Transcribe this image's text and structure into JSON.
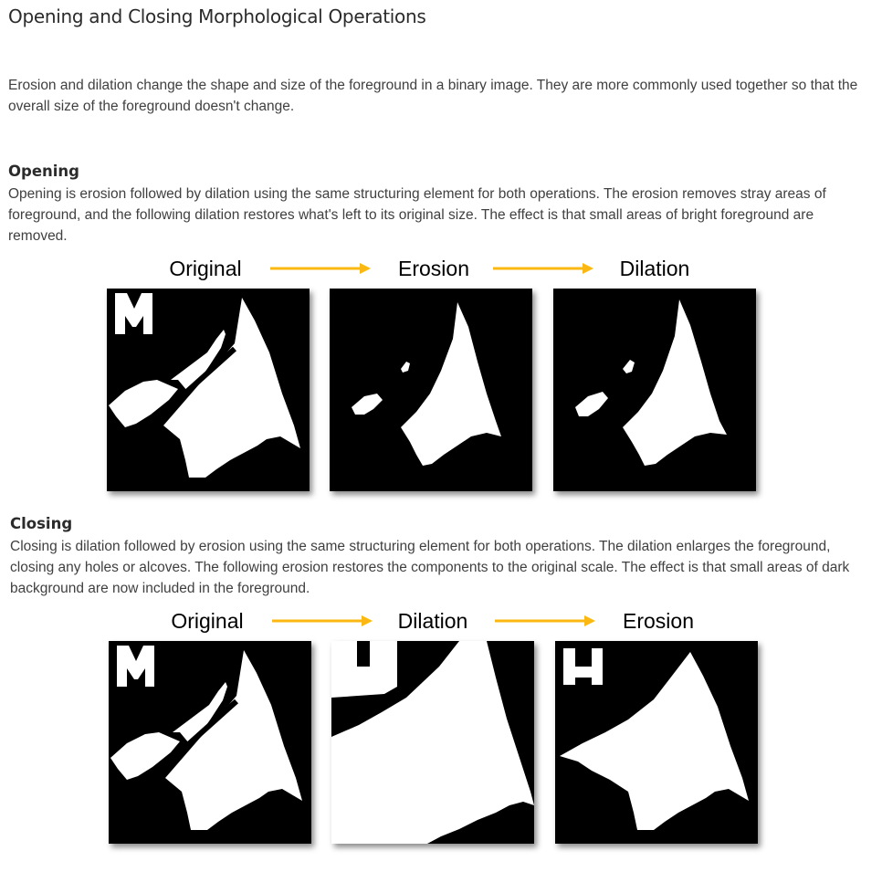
{
  "page": {
    "title": "Opening and Closing Morphological Operations",
    "intro": "Erosion and dilation change the shape and size of the foreground in a binary image. They are more commonly used together so that the overall size of the foreground doesn't change."
  },
  "opening": {
    "heading": "Opening",
    "text": "Opening is erosion followed by dilation using the same structuring element for both operations. The erosion removes stray areas of foreground, and the following dilation restores what's left to its original size. The effect is that small areas of bright foreground are removed.",
    "stages": [
      "Original",
      "Erosion",
      "Dilation"
    ]
  },
  "closing": {
    "heading": "Closing",
    "text": "Closing is dilation followed by erosion using the same structuring element for both operations. The dilation enlarges the foreground, closing any holes or alcoves. The following erosion restores the components to the original scale. The effect is that small areas of dark background are now included in the foreground.",
    "stages": [
      "Original",
      "Dilation",
      "Erosion"
    ]
  },
  "colors": {
    "arrow": "#fbb812",
    "foreground": "#ffffff",
    "background": "#000000"
  }
}
